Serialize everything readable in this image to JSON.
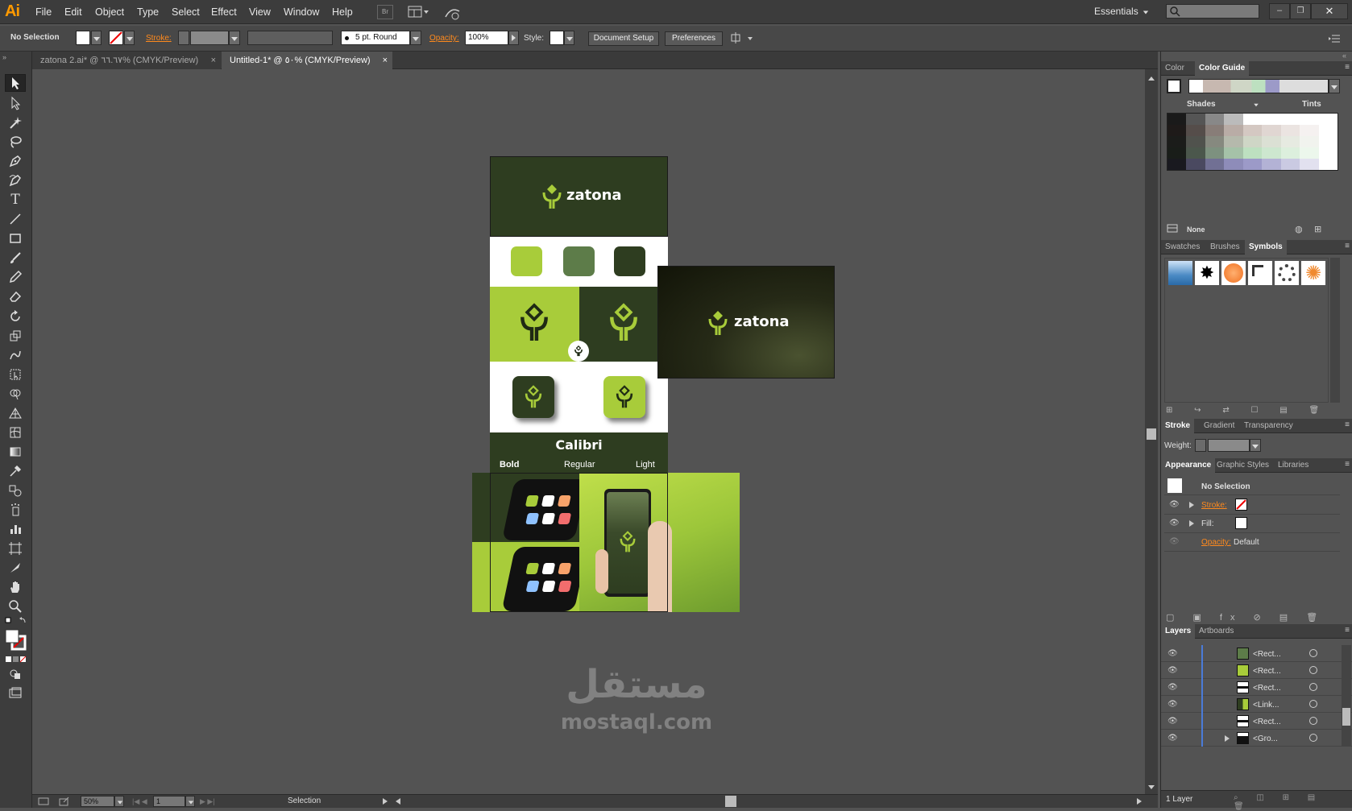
{
  "app": {
    "logo": "Ai"
  },
  "menu": [
    "File",
    "Edit",
    "Object",
    "Type",
    "Select",
    "Effect",
    "View",
    "Window",
    "Help"
  ],
  "workspace": "Essentials",
  "control": {
    "selection": "No Selection",
    "stroke_label": "Stroke:",
    "brush": "5 pt. Round",
    "opacity_label": "Opacity:",
    "opacity_value": "100%",
    "style_label": "Style:",
    "document_setup": "Document Setup",
    "preferences": "Preferences"
  },
  "tabs": [
    {
      "label": "zatona 2.ai* @ ٦٦.٦٧% (CMYK/Preview)",
      "active": false
    },
    {
      "label": "Untitled-1* @ ٥٠% (CMYK/Preview)",
      "active": true
    }
  ],
  "artboard": {
    "brand": "zatona",
    "font_name": "Calibri",
    "weights": [
      "Bold",
      "Regular",
      "Light"
    ]
  },
  "card": {
    "brand": "zatona"
  },
  "watermark": {
    "arabic": "مستقل",
    "latin": "mostaql.com"
  },
  "status": {
    "zoom": "50%",
    "page": "1",
    "tool": "Selection"
  },
  "color_panel": {
    "tabs": [
      "Color",
      "Color Guide"
    ],
    "shades": "Shades",
    "tints": "Tints",
    "none": "None"
  },
  "symbols_panel": {
    "tabs": [
      "Swatches",
      "Brushes",
      "Symbols"
    ]
  },
  "stroke_panel": {
    "tabs": [
      "Stroke",
      "Gradient",
      "Transparency"
    ],
    "weight_label": "Weight:"
  },
  "appearance_panel": {
    "tabs": [
      "Appearance",
      "Graphic Styles",
      "Libraries"
    ],
    "title": "No Selection",
    "stroke": "Stroke:",
    "fill": "Fill:",
    "opacity": "Opacity:",
    "opacity_value": "Default"
  },
  "layers_panel": {
    "tabs": [
      "Layers",
      "Artboards"
    ],
    "rows": [
      "<Rect...",
      "<Rect...",
      "<Rect...",
      "<Link...",
      "<Rect...",
      "<Gro..."
    ],
    "footer": "1 Layer"
  },
  "colors": {
    "dark_green": "#2e3d20",
    "lime": "#a8cc3a",
    "mid_green": "#5d7c49",
    "accent": "#ff9a00"
  }
}
